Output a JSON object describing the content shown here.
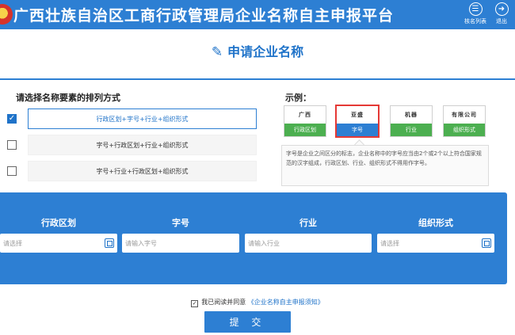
{
  "header": {
    "title": "广西壮族自治区工商行政管理局企业名称自主申报平台",
    "list_label": "核名列表",
    "logout_label": "退出",
    "list_icon": "list-icon",
    "logout_icon": "logout-icon"
  },
  "page": {
    "title": "申请企业名称",
    "title_icon": "edit-icon"
  },
  "arrangement": {
    "heading": "请选择名称要素的排列方式",
    "options": [
      {
        "label": "行政区划+字号+行业+组织形式",
        "checked": true
      },
      {
        "label": "字号+行政区划+行业+组织形式",
        "checked": false
      },
      {
        "label": "字号+行业+行政区划+组织形式",
        "checked": false
      }
    ]
  },
  "example": {
    "heading": "示例：",
    "cards": [
      {
        "sample": "广西",
        "label": "行政区划",
        "active": false
      },
      {
        "sample": "亚盛",
        "label": "字号",
        "active": true
      },
      {
        "sample": "机器",
        "label": "行业",
        "active": false
      },
      {
        "sample": "有限公司",
        "label": "组织形式",
        "active": false
      }
    ],
    "tip": "字号是企业之间区分的标志，企业名称中的字号应当由2个或2个以上符合国家规范的汉字组成，行政区划、行业、组织形式不得用作字号。"
  },
  "form": {
    "fields": [
      {
        "label": "行政区划",
        "value": "",
        "placeholder": "请选择",
        "has_picker": true
      },
      {
        "label": "字号",
        "value": "",
        "placeholder": "请输入字号",
        "has_picker": false
      },
      {
        "label": "行业",
        "value": "",
        "placeholder": "请输入行业",
        "has_picker": false
      },
      {
        "label": "组织形式",
        "value": "",
        "placeholder": "请选择",
        "has_picker": true
      }
    ]
  },
  "agreement": {
    "checked": true,
    "prefix": "我已阅读并同意",
    "link": "《企业名称自主申报须知》"
  },
  "submit_label": "提 交",
  "colors": {
    "primary": "#2d7fd3",
    "selected_border": "#e53935",
    "sample_green": "#4caf50"
  }
}
